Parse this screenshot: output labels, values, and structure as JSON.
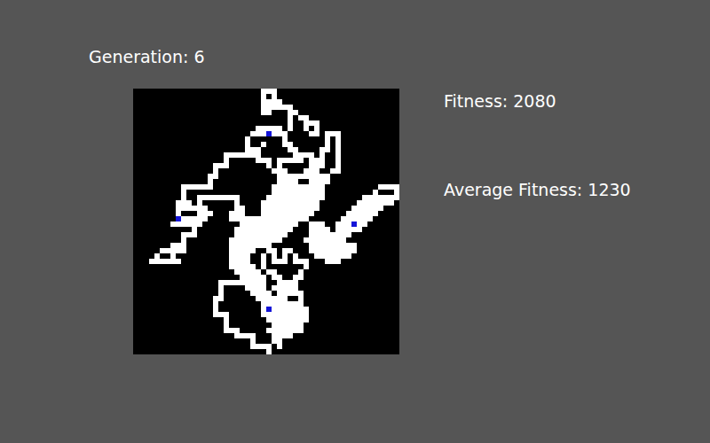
{
  "generation": {
    "label": "Generation: 6"
  },
  "stats": [
    {
      "label": "Fitness: 2080"
    },
    {
      "label": "Average Fitness: 1230"
    }
  ],
  "board": {
    "cols": 50,
    "rows": 50,
    "white_runs": [
      [
        [
          24,
          26
        ]
      ],
      [
        [
          24,
          24
        ],
        [
          26,
          26
        ]
      ],
      [
        [
          24,
          27
        ]
      ],
      [
        [
          24,
          29
        ]
      ],
      [
        [
          24,
          25
        ],
        [
          29,
          30
        ]
      ],
      [
        [
          29,
          29
        ],
        [
          31,
          32
        ]
      ],
      [
        [
          29,
          29
        ],
        [
          32,
          34
        ]
      ],
      [
        [
          23,
          27
        ],
        [
          29,
          29
        ],
        [
          32,
          32
        ],
        [
          34,
          34
        ]
      ],
      [
        [
          22,
          24
        ],
        [
          26,
          28
        ],
        [
          33,
          34
        ],
        [
          36,
          38
        ]
      ],
      [
        [
          21,
          21
        ],
        [
          28,
          28
        ],
        [
          36,
          36
        ],
        [
          38,
          38
        ]
      ],
      [
        [
          21,
          21
        ],
        [
          24,
          24
        ],
        [
          28,
          29
        ],
        [
          36,
          36
        ],
        [
          38,
          38
        ]
      ],
      [
        [
          21,
          23
        ],
        [
          29,
          30
        ],
        [
          35,
          36
        ],
        [
          38,
          38
        ]
      ],
      [
        [
          17,
          23
        ],
        [
          30,
          33
        ],
        [
          35,
          35
        ],
        [
          38,
          38
        ]
      ],
      [
        [
          17,
          17
        ],
        [
          23,
          25
        ],
        [
          27,
          31
        ],
        [
          33,
          35
        ],
        [
          38,
          38
        ]
      ],
      [
        [
          15,
          17
        ],
        [
          25,
          25
        ],
        [
          27,
          27
        ],
        [
          33,
          35
        ],
        [
          38,
          38
        ]
      ],
      [
        [
          15,
          15
        ],
        [
          26,
          28
        ],
        [
          32,
          34
        ],
        [
          37,
          38
        ]
      ],
      [
        [
          14,
          15
        ],
        [
          27,
          36
        ]
      ],
      [
        [
          14,
          14
        ],
        [
          27,
          30
        ],
        [
          33,
          36
        ]
      ],
      [
        [
          9,
          14
        ],
        [
          26,
          35
        ],
        [
          46,
          49
        ]
      ],
      [
        [
          9,
          9
        ],
        [
          26,
          35
        ],
        [
          45,
          45
        ],
        [
          49,
          49
        ]
      ],
      [
        [
          9,
          9
        ],
        [
          12,
          19
        ],
        [
          25,
          35
        ],
        [
          43,
          49
        ]
      ],
      [
        [
          8,
          10
        ],
        [
          12,
          12
        ],
        [
          19,
          19
        ],
        [
          24,
          34
        ],
        [
          42,
          48
        ]
      ],
      [
        [
          8,
          13
        ],
        [
          19,
          20
        ],
        [
          24,
          34
        ],
        [
          41,
          46
        ]
      ],
      [
        [
          8,
          8
        ],
        [
          12,
          14
        ],
        [
          18,
          20
        ],
        [
          24,
          33
        ],
        [
          40,
          45
        ]
      ],
      [
        [
          9,
          13
        ],
        [
          18,
          32
        ],
        [
          39,
          44
        ]
      ],
      [
        [
          7,
          12
        ],
        [
          20,
          30
        ],
        [
          33,
          35
        ],
        [
          38,
          40
        ],
        [
          42,
          43
        ]
      ],
      [
        [
          11,
          11
        ],
        [
          19,
          29
        ],
        [
          33,
          36
        ],
        [
          38,
          42
        ]
      ],
      [
        [
          9,
          11
        ],
        [
          19,
          28
        ],
        [
          33,
          40
        ]
      ],
      [
        [
          9,
          9
        ],
        [
          18,
          27
        ],
        [
          32,
          39
        ]
      ],
      [
        [
          7,
          9
        ],
        [
          18,
          25
        ],
        [
          33,
          41
        ]
      ],
      [
        [
          5,
          9
        ],
        [
          18,
          22
        ],
        [
          25,
          26
        ],
        [
          28,
          29
        ],
        [
          33,
          41
        ]
      ],
      [
        [
          4,
          4
        ],
        [
          7,
          7
        ],
        [
          18,
          21
        ],
        [
          24,
          24
        ],
        [
          26,
          26
        ],
        [
          28,
          28
        ],
        [
          30,
          30
        ],
        [
          34,
          40
        ]
      ],
      [
        [
          3,
          8
        ],
        [
          18,
          21
        ],
        [
          24,
          24
        ],
        [
          26,
          28
        ],
        [
          30,
          32
        ],
        [
          36,
          38
        ]
      ],
      [
        [
          18,
          22
        ],
        [
          24,
          24
        ],
        [
          32,
          32
        ]
      ],
      [
        [
          19,
          23
        ],
        [
          25,
          26
        ],
        [
          31,
          31
        ]
      ],
      [
        [
          20,
          24
        ],
        [
          26,
          27
        ],
        [
          30,
          31
        ]
      ],
      [
        [
          16,
          24
        ],
        [
          27,
          30
        ]
      ],
      [
        [
          16,
          16
        ],
        [
          21,
          24
        ],
        [
          26,
          30
        ]
      ],
      [
        [
          16,
          16
        ],
        [
          22,
          25
        ],
        [
          27,
          31
        ]
      ],
      [
        [
          15,
          16
        ],
        [
          23,
          28
        ],
        [
          31,
          31
        ]
      ],
      [
        [
          15,
          15
        ],
        [
          24,
          31
        ]
      ],
      [
        [
          15,
          15
        ],
        [
          24,
          24
        ],
        [
          26,
          32
        ]
      ],
      [
        [
          15,
          17
        ],
        [
          24,
          32
        ]
      ],
      [
        [
          17,
          17
        ],
        [
          25,
          32
        ]
      ],
      [
        [
          17,
          17
        ],
        [
          26,
          31
        ]
      ],
      [
        [
          17,
          19
        ],
        [
          25,
          31
        ]
      ],
      [
        [
          19,
          22
        ],
        [
          26,
          29
        ]
      ],
      [
        [
          22,
          22
        ],
        [
          26,
          27
        ]
      ],
      [
        [
          22,
          25
        ],
        [
          27,
          27
        ]
      ],
      [
        [
          25,
          25
        ]
      ]
    ],
    "blue_dots": [
      [
        25,
        8
      ],
      [
        8,
        24
      ],
      [
        41,
        25
      ],
      [
        25,
        41
      ]
    ]
  }
}
